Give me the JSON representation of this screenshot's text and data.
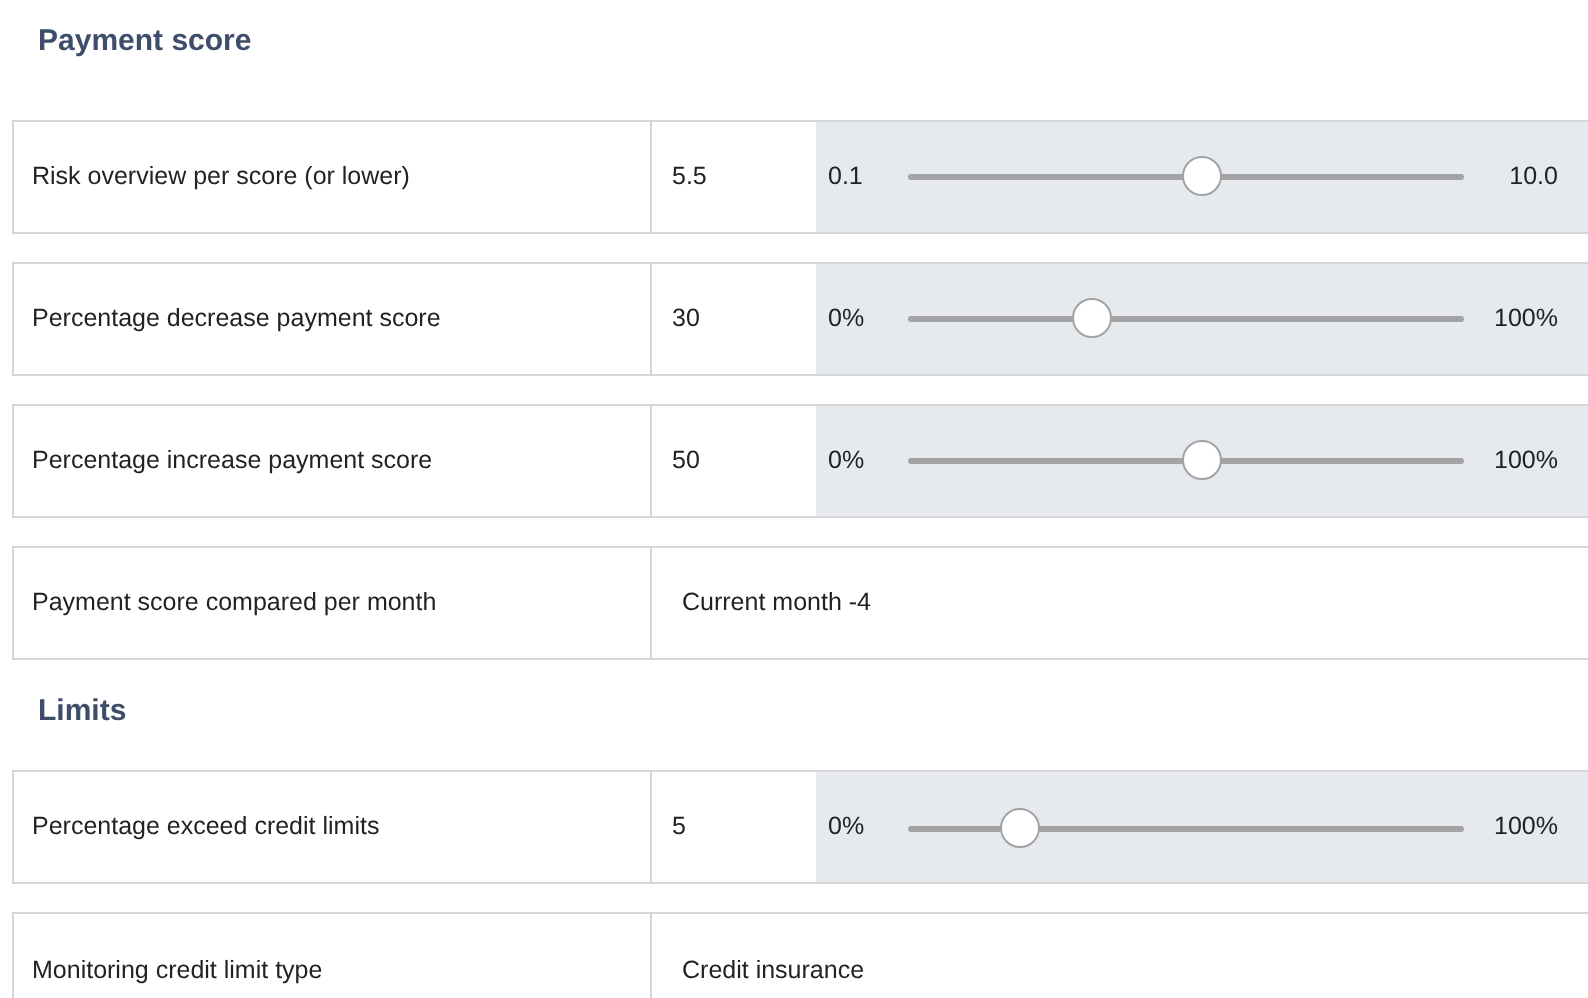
{
  "sections": [
    {
      "title": "Payment score",
      "rows": [
        {
          "kind": "slider",
          "label": "Risk overview per score (or lower)",
          "value": "5.5",
          "min": "0.1",
          "max": "10.0",
          "level": 0.53
        },
        {
          "kind": "slider",
          "label": "Percentage decrease payment score",
          "value": "30",
          "min": "0%",
          "max": "100%",
          "level": 0.33
        },
        {
          "kind": "slider",
          "label": "Percentage increase payment score",
          "value": "50",
          "min": "0%",
          "max": "100%",
          "level": 0.53
        },
        {
          "kind": "text",
          "label": "Payment score compared per month",
          "value": "Current month -4"
        }
      ]
    },
    {
      "title": "Limits",
      "rows": [
        {
          "kind": "slider",
          "label": "Percentage exceed credit limits",
          "value": "5",
          "min": "0%",
          "max": "100%",
          "level": 0.2
        },
        {
          "kind": "text",
          "label": "Monitoring credit limit type",
          "value": "Credit insurance"
        }
      ]
    }
  ]
}
